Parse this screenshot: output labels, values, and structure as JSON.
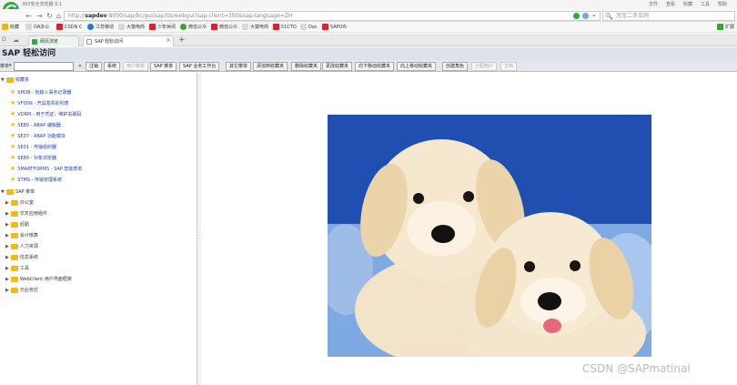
{
  "browser": {
    "title": "360安全浏览器 8.1",
    "menu": [
      "文件",
      "查看",
      "收藏",
      "工具",
      "帮助"
    ],
    "url_prefix": "http://",
    "url_host": "sapdev",
    "url_rest": ":8000/sap/bc/gui/sap/its/webgui?sap-client=300&sap-language=ZH",
    "search_placeholder": "淘宝二手车网",
    "bookmarks": [
      "收藏",
      "OA办公",
      "CSDN C",
      "江苏移动",
      "大猿电商",
      "少年休闲",
      "微信公众",
      "微信公众",
      "大猿电商",
      "51CTO",
      "Doc",
      "SAPUI5"
    ],
    "bookmark_extra": "扩展",
    "tabs": [
      "网页浏览",
      "SAP 轻松访问"
    ]
  },
  "colors": {
    "brand": "#2eaa3c",
    "favorite_text": "#1a3fb8",
    "folder": "#f2b91b",
    "sap_red": "#d6262c"
  },
  "sap": {
    "title": "SAP 轻松访问",
    "menu_label": "菜单",
    "toolbar": [
      "注销",
      "系统",
      "用户菜单",
      "SAP 菜单",
      "SAP 业务工作台",
      "其它菜单",
      "添加到收藏夹",
      "删除收藏夹",
      "更改收藏夹",
      "向下移动收藏夹",
      "向上移动收藏夹",
      "创建角色",
      "分配用户",
      "文档"
    ],
    "favorites_label": "收藏夹",
    "favorites": [
      "SHDB - 批输入事务记录器",
      "VF05N - 开具发票的列表",
      "VDRM - 用于凭证：维护关联码",
      "SE80 - ABAP 编辑器",
      "SE37 - ABAP 功能模块",
      "SE01 - 传输组织器",
      "SE80 - 对象浏览器",
      "SMARTFORMS - SAP 智能表单",
      "STMS - 传输管理系统"
    ],
    "sap_menu_label": "SAP 菜单",
    "sap_menu": [
      "办公室",
      "交叉应用组件",
      "后勤",
      "会计核算",
      "人力资源",
      "信息系统",
      "工具",
      "WebClient 用户界面框架",
      "元业务应"
    ]
  },
  "watermark": "CSDN @SAPmatinal"
}
